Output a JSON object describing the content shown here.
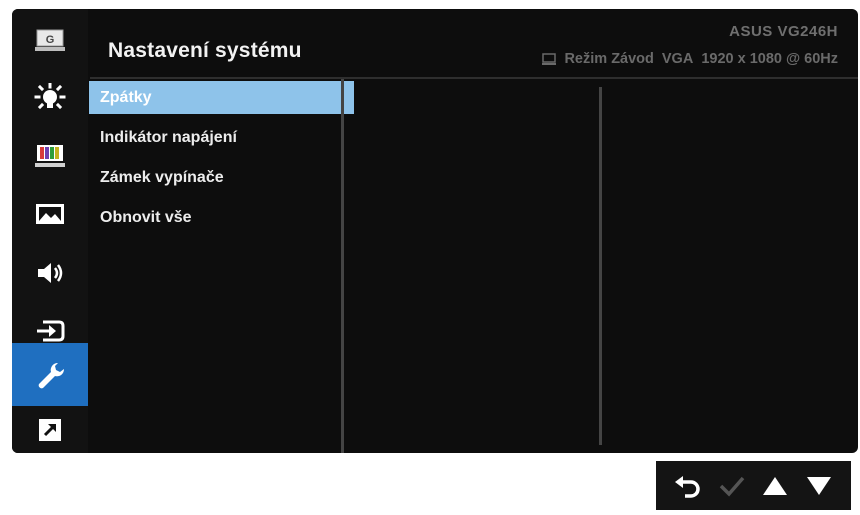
{
  "header": {
    "title": "Nastavení systému",
    "model": "ASUS VG246H",
    "mode": "Režim Závod",
    "input": "VGA",
    "resolution": "1920 x 1080 @ 60Hz"
  },
  "sidebar": {
    "items": [
      {
        "name": "splendid",
        "icon": "g-splendid-icon"
      },
      {
        "name": "brightness",
        "icon": "brightness-icon"
      },
      {
        "name": "color",
        "icon": "color-bars-icon"
      },
      {
        "name": "image",
        "icon": "picture-icon"
      },
      {
        "name": "sound",
        "icon": "speaker-icon"
      },
      {
        "name": "input",
        "icon": "input-source-icon"
      },
      {
        "name": "system",
        "icon": "wrench-icon",
        "active": true
      },
      {
        "name": "shortcut",
        "icon": "shortcut-icon"
      }
    ]
  },
  "menu": {
    "items": [
      {
        "label": "Zpátky",
        "selected": true
      },
      {
        "label": "Indikátor napájení"
      },
      {
        "label": "Zámek vypínače"
      },
      {
        "label": "Obnovit vše"
      }
    ]
  },
  "nav": {
    "buttons": [
      "back-icon",
      "check-icon",
      "up-arrow-icon",
      "down-arrow-icon"
    ]
  },
  "colors": {
    "active_tab": "#1f6fc0",
    "selected_item": "#8ec3ea",
    "background": "#0d0d0d"
  }
}
